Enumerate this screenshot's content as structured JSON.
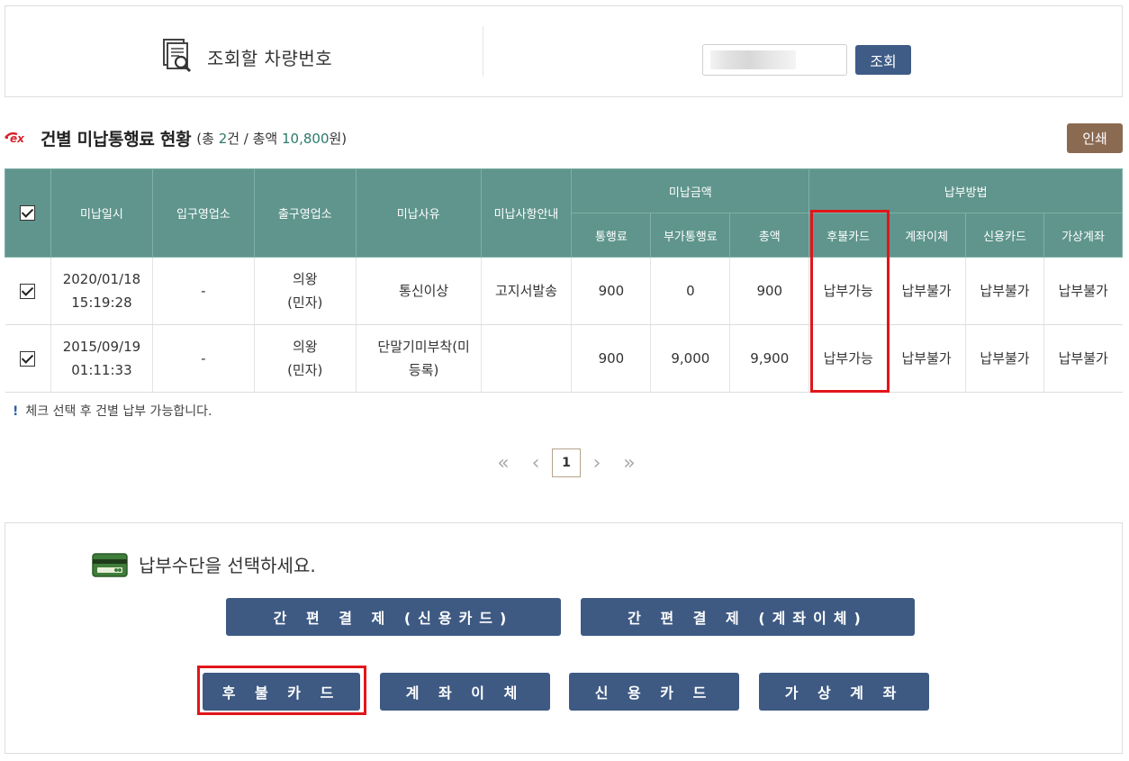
{
  "search": {
    "label": "조회할 차량번호",
    "button": "조회"
  },
  "section": {
    "title": "건별 미납통행료 현황",
    "sub_prefix": "(총 ",
    "count": "2",
    "sub_mid": "건 / 총액 ",
    "total": "10,800",
    "sub_suffix": "원)",
    "print": "인쇄"
  },
  "table": {
    "headers": {
      "date": "미납일시",
      "entry": "입구영업소",
      "exit": "출구영업소",
      "reason": "미납사유",
      "notice": "미납사항안내",
      "amount_group": "미납금액",
      "toll": "통행료",
      "surcharge": "부가통행료",
      "sum": "총액",
      "method_group": "납부방법",
      "deferred": "후불카드",
      "transfer": "계좌이체",
      "credit": "신용카드",
      "virtual": "가상계좌"
    },
    "rows": [
      {
        "date": "2020/01/18",
        "time": "15:19:28",
        "entry": "-",
        "exit1": "의왕",
        "exit2": "(민자)",
        "reason1": "통신이상",
        "reason2": "",
        "notice": "고지서발송",
        "toll": "900",
        "surcharge": "0",
        "sum": "900",
        "deferred": "납부가능",
        "transfer": "납부불가",
        "credit": "납부불가",
        "virtual": "납부불가"
      },
      {
        "date": "2015/09/19",
        "time": "01:11:33",
        "entry": "-",
        "exit1": "의왕",
        "exit2": "(민자)",
        "reason1": "단말기미부착(미",
        "reason2": "등록)",
        "notice": "",
        "toll": "900",
        "surcharge": "9,000",
        "sum": "9,900",
        "deferred": "납부가능",
        "transfer": "납부불가",
        "credit": "납부불가",
        "virtual": "납부불가"
      }
    ]
  },
  "notice": {
    "bang": "!",
    "text": "체크 선택 후 건별 납부 가능합니다."
  },
  "pager": {
    "first": "«",
    "prev": "‹",
    "current": "1",
    "next": "›",
    "last": "»"
  },
  "payment": {
    "title": "납부수단을 선택하세요.",
    "easy_card": "간 편 결 제 (신용카드)",
    "easy_transfer": "간 편 결 제 (계좌이체)",
    "deferred": "후 불 카 드",
    "transfer": "계 좌 이 체",
    "credit": "신 용 카 드",
    "virtual": "가 상 계 좌"
  },
  "colors": {
    "header_bg": "#5f958c",
    "button_bg": "#3e5a83",
    "print_bg": "#8b6a52",
    "highlight": "#e0161b",
    "accent_text": "#2c7a6b"
  },
  "icons": [
    "document-search-icon",
    "ex-logo",
    "card-icon",
    "checkbox-icon"
  ]
}
